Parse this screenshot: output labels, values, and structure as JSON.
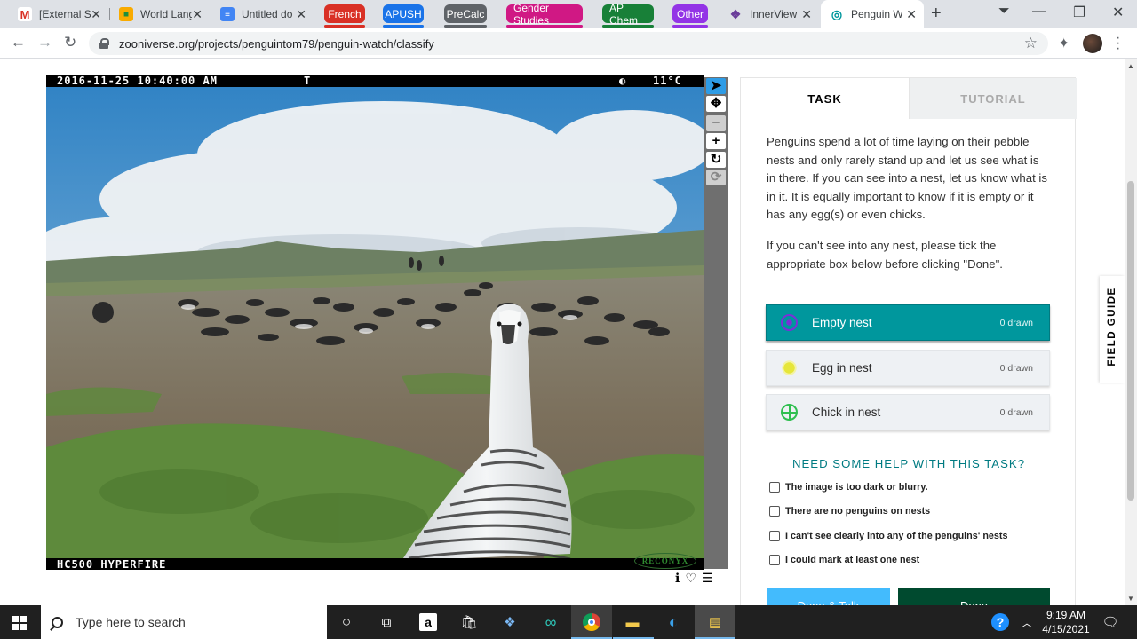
{
  "browser": {
    "tabs": [
      {
        "title": "[External Se",
        "icon": "gmail-icon"
      },
      {
        "title": "World Lang",
        "icon": "classroom-icon"
      },
      {
        "title": "Untitled do",
        "icon": "docs-icon"
      },
      {
        "title": "InnerView",
        "icon": "innerview-icon"
      },
      {
        "title": "Penguin W",
        "icon": "zooniverse-icon",
        "active": true
      }
    ],
    "tab_groups": [
      {
        "label": "French",
        "color": "#d93025"
      },
      {
        "label": "APUSH",
        "color": "#1a73e8"
      },
      {
        "label": "PreCalc",
        "color": "#5f6368"
      },
      {
        "label": "Gender Studies",
        "color": "#d01884"
      },
      {
        "label": "AP Chem",
        "color": "#188038"
      },
      {
        "label": "Other",
        "color": "#9334e6"
      }
    ],
    "url": "zooniverse.org/projects/penguintom79/penguin-watch/classify"
  },
  "subject": {
    "datetime": "2016-11-25 10:40:00 AM",
    "flag": "T",
    "moon": "◐",
    "temperature": "11°C",
    "camera_model": "HC500 HYPERFIRE",
    "brand": "RECONYX"
  },
  "task_panel": {
    "tab_task": "TASK",
    "tab_tutorial": "TUTORIAL",
    "instructions": [
      "Penguins spend a lot of time laying on their pebble nests and only rarely stand up and let us see what is in there. If you can see into a nest, let us know what is in it. It is equally important to know if it is empty or it has any egg(s) or even chicks.",
      "If you can't see into any nest, please tick the appropriate box below before clicking \"Done\"."
    ],
    "tools": [
      {
        "label": "Empty nest",
        "count": "0 drawn",
        "color": "#7b2fd8",
        "selected": true
      },
      {
        "label": "Egg in nest",
        "count": "0 drawn",
        "color": "#e6e63a"
      },
      {
        "label": "Chick in nest",
        "count": "0 drawn",
        "color": "#2fbf4f"
      }
    ],
    "help_title": "NEED SOME HELP WITH THIS TASK?",
    "help_options": [
      "The image is too dark or blurry.",
      "There are no penguins on nests",
      "I can't see clearly into any of the penguins' nests",
      "I could mark at least one nest"
    ],
    "done_talk": "Done & Talk",
    "done": "Done"
  },
  "field_guide": "FIELD GUIDE",
  "taskbar": {
    "search_placeholder": "Type here to search",
    "time": "9:19 AM",
    "date": "4/15/2021"
  }
}
